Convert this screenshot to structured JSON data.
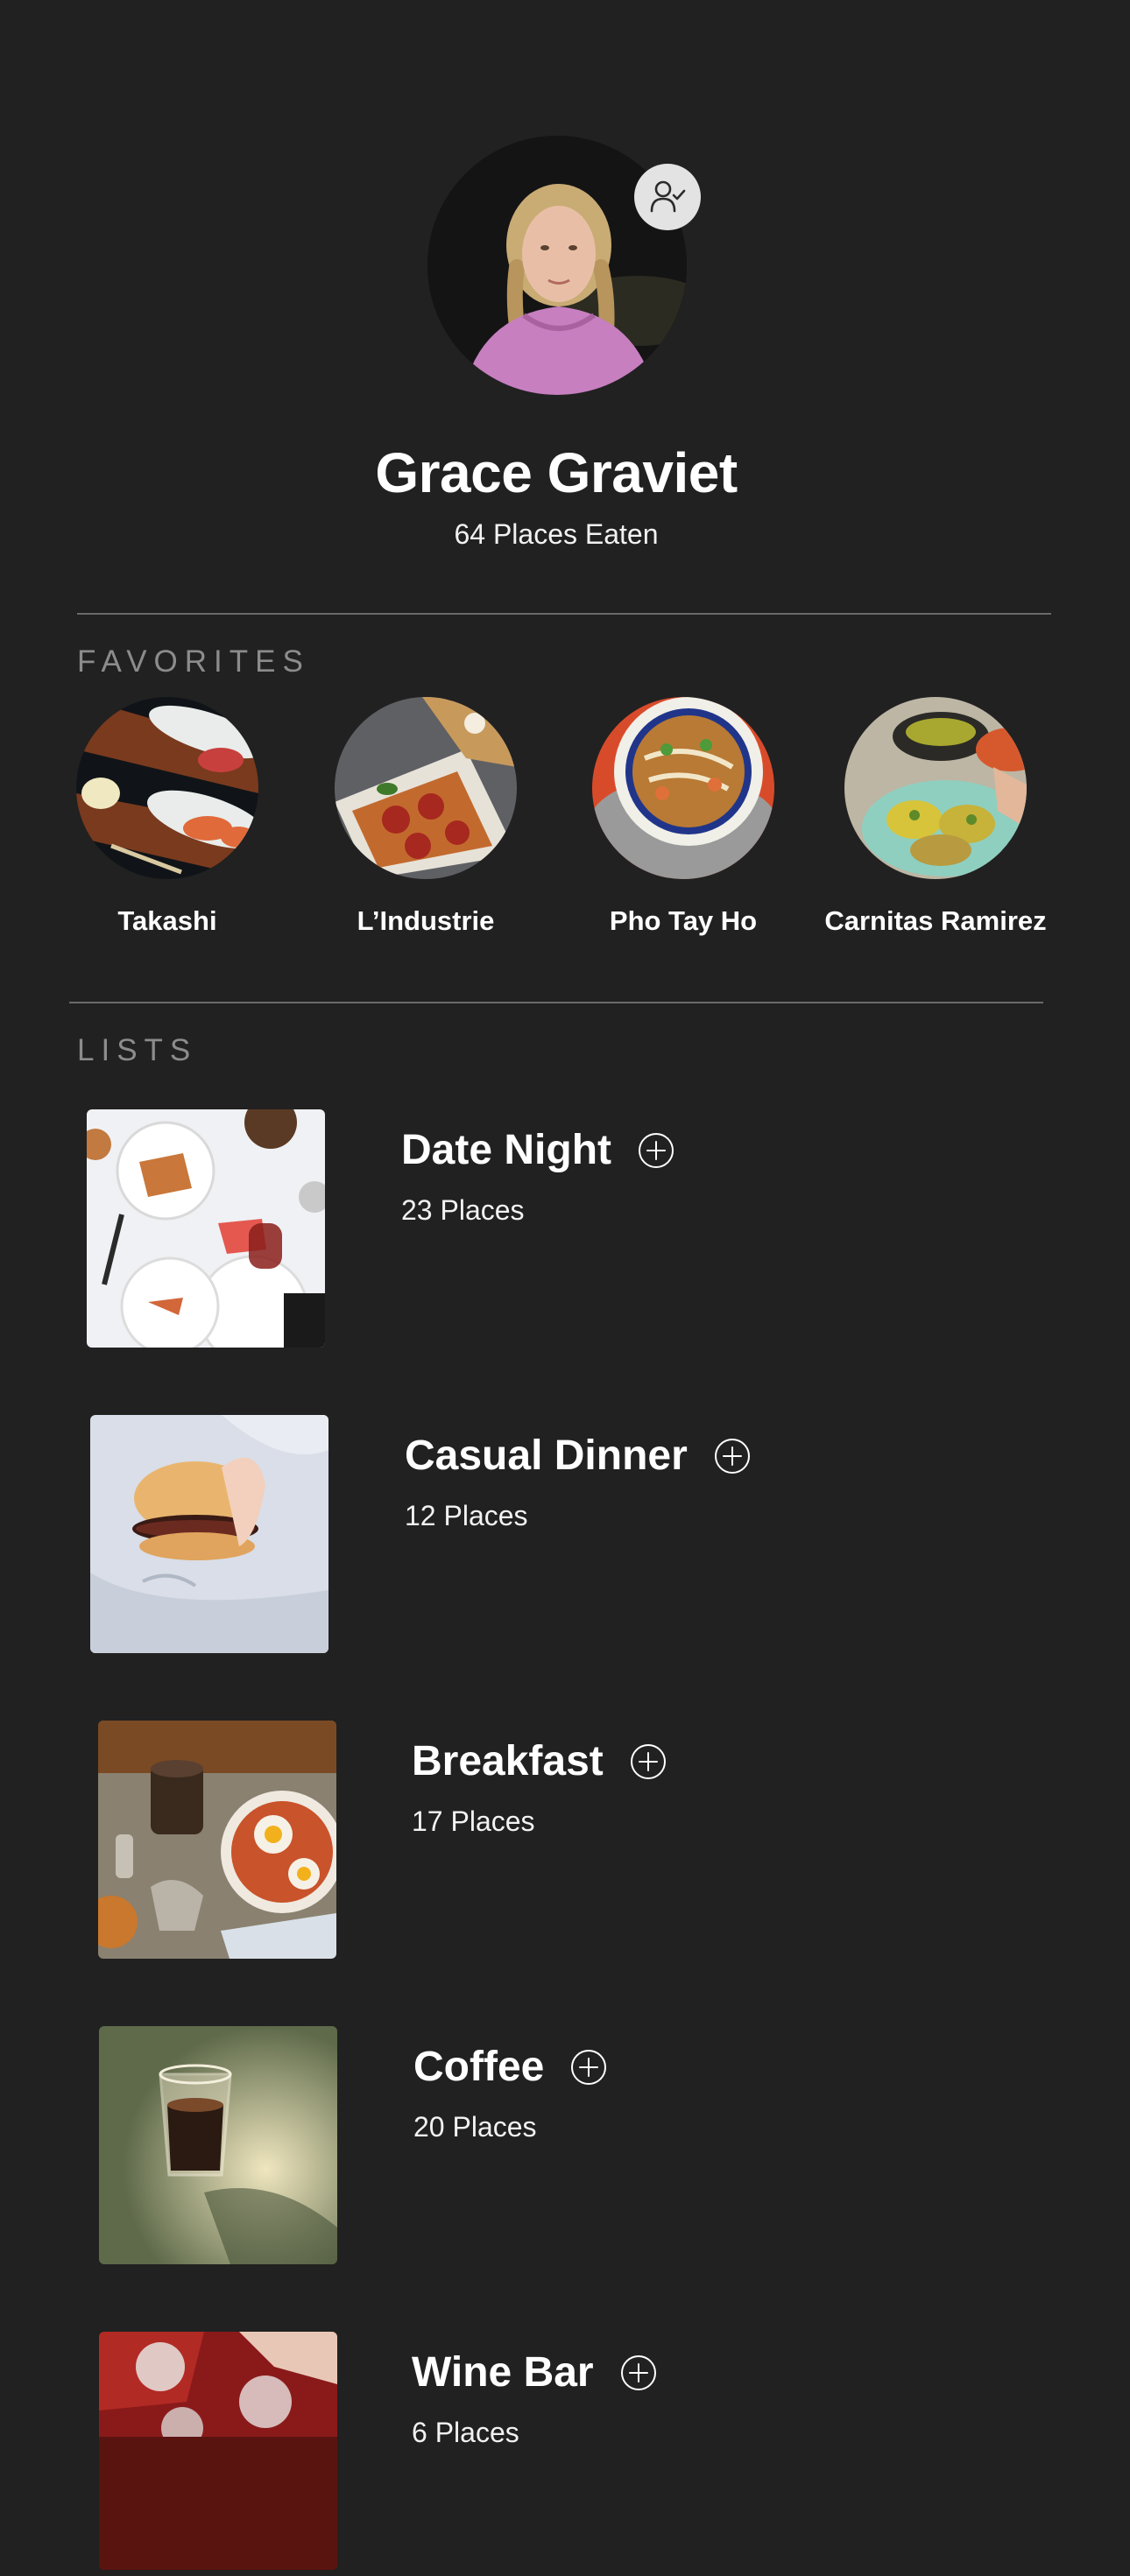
{
  "profile": {
    "name": "Grace Graviet",
    "places_eaten": "64 Places Eaten",
    "follow_icon": "user-check-icon"
  },
  "favorites": {
    "label": "FAVORITES",
    "items": [
      {
        "name": "Takashi"
      },
      {
        "name": "L’Industrie"
      },
      {
        "name": "Pho Tay Ho"
      },
      {
        "name": "Carnitas Ramirez"
      }
    ]
  },
  "lists": {
    "label": "LISTS",
    "items": [
      {
        "title": "Date Night",
        "count": "23 Places"
      },
      {
        "title": "Casual Dinner",
        "count": "12 Places"
      },
      {
        "title": "Breakfast",
        "count": "17 Places"
      },
      {
        "title": "Coffee",
        "count": "20 Places"
      },
      {
        "title": "Wine Bar",
        "count": "6 Places"
      }
    ],
    "add_icon": "plus-circle-icon"
  },
  "colors": {
    "background": "#212121",
    "divider": "#6a6a6a",
    "section_label": "#8c8c8c",
    "badge": "#e3e3e3"
  }
}
